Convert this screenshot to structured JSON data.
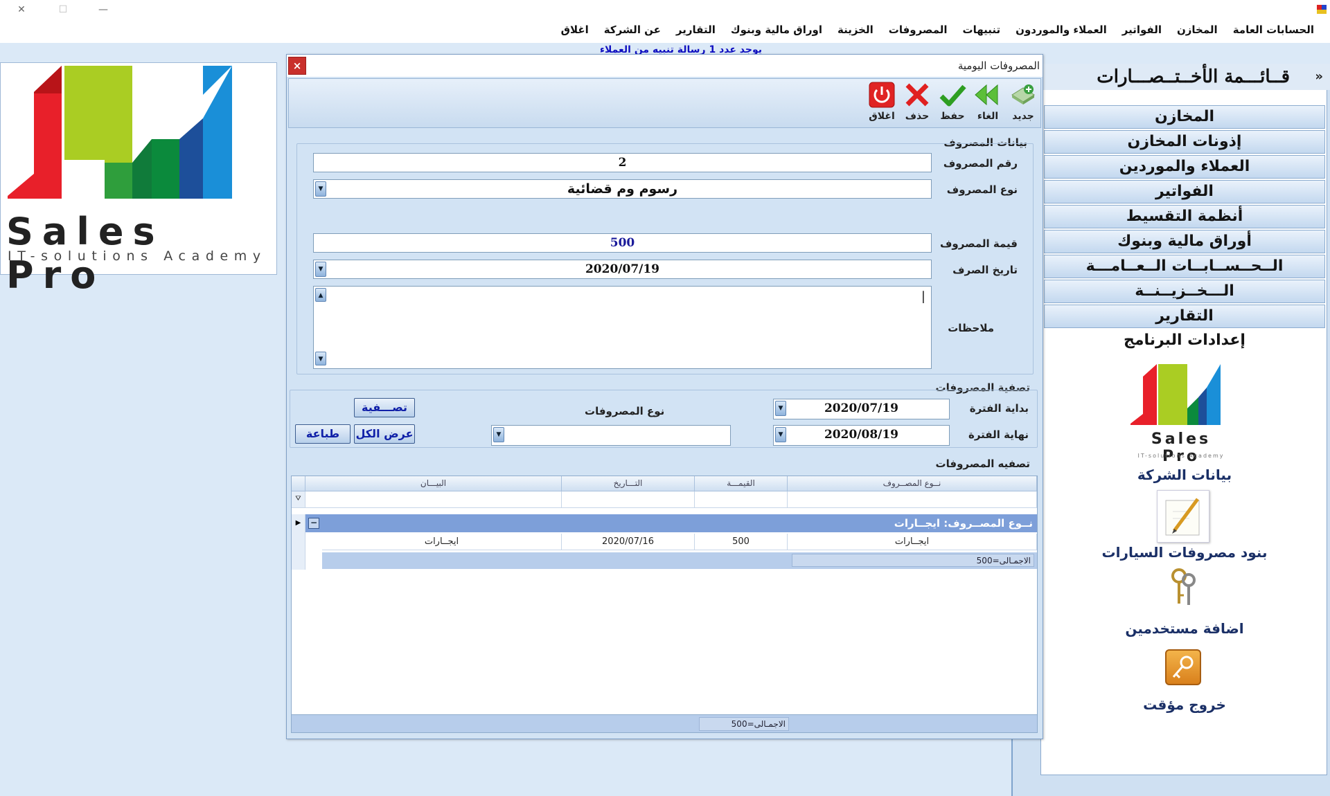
{
  "window": {
    "controls": {
      "close": "✕",
      "restore": "☐",
      "minimize": "—"
    }
  },
  "menu": {
    "items": [
      "الحسابات العامة",
      "المخازن",
      "الفواتير",
      "العملاء والموردون",
      "تنبيهات",
      "المصروفات",
      "الخزينة",
      "اوراق مالية وبنوك",
      "التقارير",
      "عن الشركة",
      "اغلاق"
    ]
  },
  "notice": "يوجد عدد 1 رسالة تنبيه من العملاء",
  "logo": {
    "title": "Sales Pro",
    "subtitle": "IT-solutions Academy"
  },
  "sidebar": {
    "title": "قــائـــمة الأخــتــصـــارات",
    "collapse": "»",
    "items": [
      "المخازن",
      "إذونات المخازن",
      "العملاء والموردين",
      "الفواتير",
      "أنظمة التقسيط",
      "أوراق مالية وبنوك",
      "الــحــســابــات الــعــامـــة",
      "الـــخــزيــنــة",
      "التقارير"
    ],
    "settings": "إعدادات البرنامج",
    "logo_title": "Sales Pro",
    "logo_subtitle": "IT-solutions Academy",
    "links": [
      "بيانات الشركة",
      "بنود مصروفات السيارات",
      "اضافة مستخدمين",
      "خروج مؤقت"
    ]
  },
  "dialog": {
    "title": "المصروفات اليومية",
    "close": "×",
    "toolbar": {
      "new": "جديد",
      "cancel": "الغاء",
      "save": "حفظ",
      "delete": "حذف",
      "close": "اغلاق"
    },
    "expense_section": "بيانات المصروف",
    "fields": {
      "number_label": "رقم المصروف",
      "number_value": "2",
      "type_label": "نوع المصروف",
      "type_value": "رسوم وم قضائية",
      "amount_label": "قيمة المصروف",
      "amount_value": "500",
      "date_label": "تاريخ الصرف",
      "date_value": "2020/07/19",
      "notes_label": "ملاحظات",
      "notes_value": ""
    },
    "filter_section": "تصفية المصروفات",
    "filter": {
      "start_label": "بداية الفترة",
      "start_value": "2020/07/19",
      "end_label": "نهاية الفترة",
      "end_value": "2020/08/19",
      "type_label": "نوع المصروفات",
      "type_value": "",
      "filter_button": "تصـــفية",
      "show_all_button": "عرض الكل",
      "print_button": "طباعة"
    },
    "grid_section": "تصفيه المصروفات",
    "grid": {
      "columns": [
        "نــوع المصــروف",
        "القيمـــة",
        "التـــاريخ",
        "البيـــان"
      ],
      "group_label": "نــوع المصــروف: ايجــارات",
      "rows": [
        {
          "type": "ايجــارات",
          "amount": "500",
          "date": "2020/07/16",
          "desc": "ايجــارات"
        }
      ],
      "group_total": "الاجمـالى=500",
      "grand_total": "الاجمـالى=500"
    }
  }
}
